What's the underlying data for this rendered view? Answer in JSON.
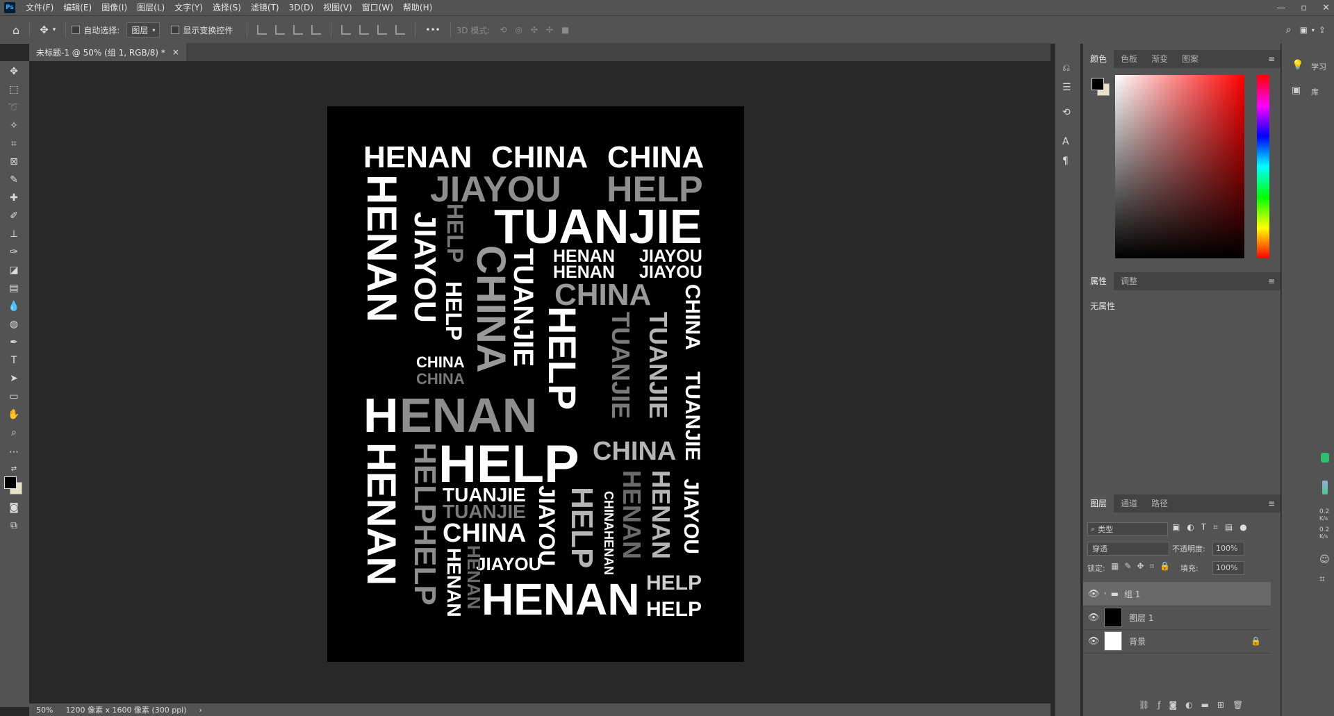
{
  "app": {
    "logo": "Ps"
  },
  "menu": [
    "文件(F)",
    "编辑(E)",
    "图像(I)",
    "图层(L)",
    "文字(Y)",
    "选择(S)",
    "滤镜(T)",
    "3D(D)",
    "视图(V)",
    "窗口(W)",
    "帮助(H)"
  ],
  "window_controls": [
    "—",
    "▫",
    "✕"
  ],
  "options": {
    "auto_select_label": "自动选择:",
    "auto_select_value": "图层",
    "show_transform_label": "显示变换控件",
    "more": "•••",
    "mode_3d_label": "3D 模式:"
  },
  "document_tab": {
    "title": "未标题-1 @ 50% (组 1, RGB/8) *",
    "close": "×"
  },
  "status": {
    "zoom": "50%",
    "info": "1200 像素 x 1600 像素 (300 ppi)",
    "arrow": "›"
  },
  "color_panel": {
    "tabs": [
      "颜色",
      "色板",
      "渐变",
      "图案"
    ],
    "foreground": "#000000",
    "background": "#ffffff"
  },
  "properties_panel": {
    "tabs": [
      "属性",
      "调整"
    ],
    "content": "无属性"
  },
  "layers_panel": {
    "tabs": [
      "图层",
      "通道",
      "路径"
    ],
    "filter_label": "类型",
    "blend_mode": "穿透",
    "opacity_label": "不透明度:",
    "opacity_value": "100%",
    "lock_label": "锁定:",
    "fill_label": "填充:",
    "fill_value": "100%",
    "layers": [
      {
        "name": "组 1",
        "type": "group"
      },
      {
        "name": "图层 1",
        "type": "black"
      },
      {
        "name": "背景",
        "type": "white"
      }
    ]
  },
  "right_strip": {
    "learn": "学习",
    "library": "库",
    "speed1": "0.2",
    "speed_unit1": "K/s",
    "speed2": "0.2",
    "speed_unit2": "K/s"
  },
  "artwork": {
    "words": {
      "w1": "HENAN",
      "w2": "CHINA",
      "w3": "CHINA",
      "w4": "JIAYOU",
      "w5": "HELP",
      "w6": "TUANJIE",
      "w7": "HENAN",
      "w8": "JIAYOU",
      "w9": "HELP",
      "w10": "CHINA",
      "w11": "TUANJIE",
      "w12": "HENAN",
      "w13": "JIAYOU",
      "w14": "HENAN",
      "w15": "JIAYOU",
      "w16": "CHINA",
      "w17": "HELP",
      "w18": "TUANJIE",
      "w19": "TUANJIE",
      "w20": "CHINA",
      "w21": "TUANJIE",
      "w22": "CHINA",
      "w23": "CHINA",
      "w24": "H",
      "w25": "ENAN",
      "w26": "CHINA",
      "w27": "HENAN",
      "w28": "HELPHELP",
      "w29": "HELP",
      "w30": "TUANJIE",
      "w31": "TUANJIE",
      "w32": "CHINA",
      "w33": "HENAN",
      "w34": "HENAN",
      "w35": "JIAYOU",
      "w36": "JIAYOU",
      "w37": "HELP",
      "w38": "CHINAHENAN",
      "w39": "HENAN",
      "w40": "HENAN",
      "w41": "JIAYOU",
      "w42": "HENAN",
      "w43": "HELP",
      "w44": "HELP"
    }
  }
}
